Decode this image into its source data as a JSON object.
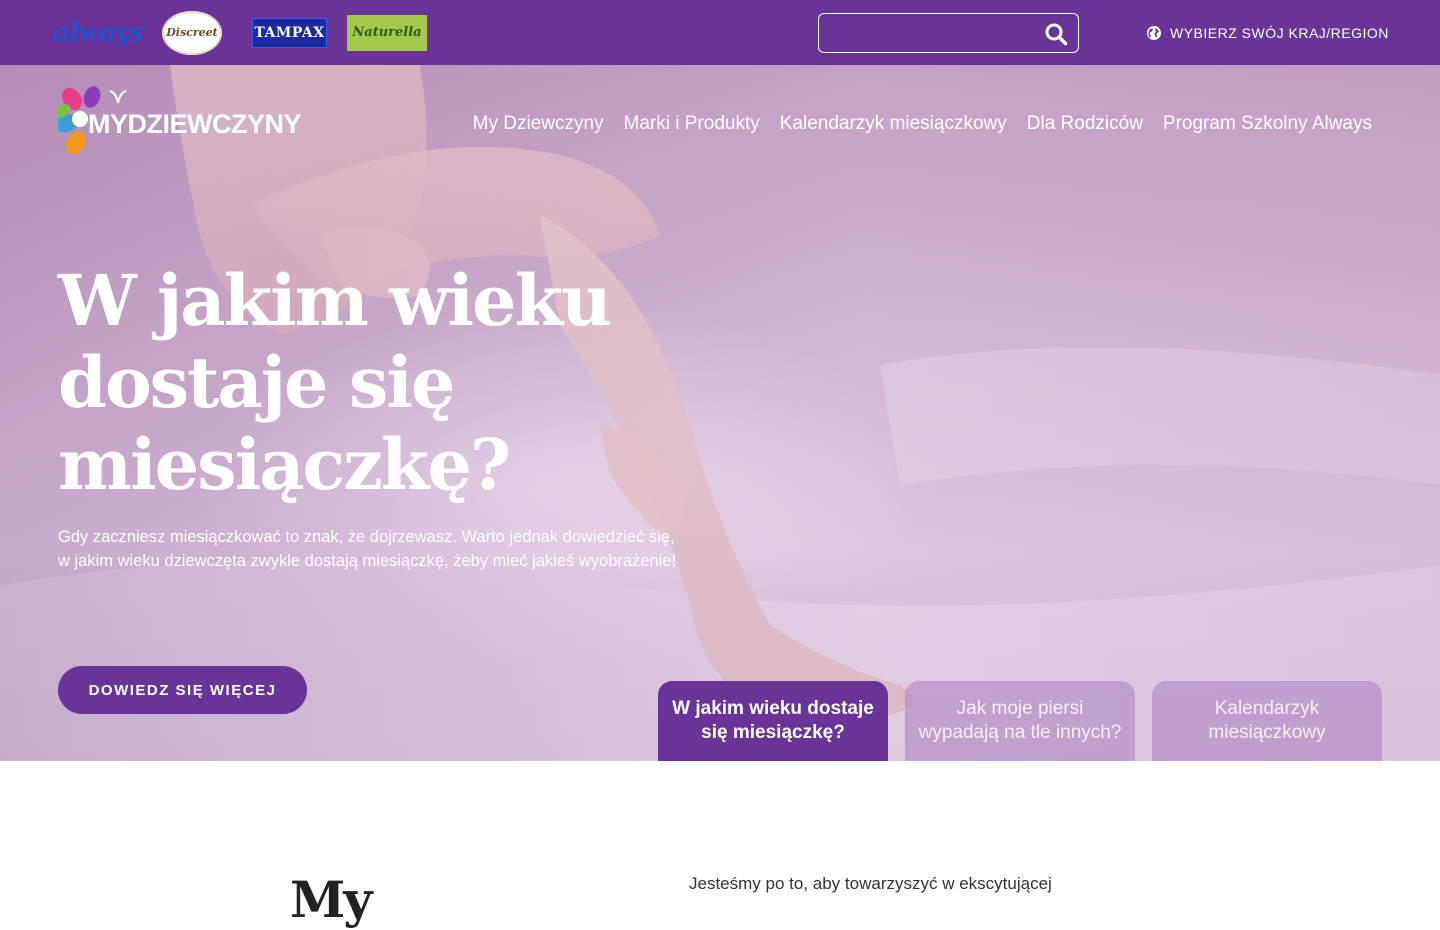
{
  "topbar": {
    "brands": [
      {
        "name": "always",
        "label": "always"
      },
      {
        "name": "discreet",
        "label": "Discreet"
      },
      {
        "name": "tampax",
        "label": "TAMPAX"
      },
      {
        "name": "naturella",
        "label": "Naturella"
      }
    ],
    "search": {
      "value": "",
      "placeholder": "",
      "icon": "search-icon"
    },
    "region": {
      "label": "WYBIERZ SWÓJ KRAJ/REGION",
      "icon": "globe-icon"
    }
  },
  "header": {
    "logo_text": "MYDZIEWCZYNY",
    "nav": [
      {
        "label": "My Dziewczyny"
      },
      {
        "label": "Marki i Produkty"
      },
      {
        "label": "Kalendarzyk miesiączkowy"
      },
      {
        "label": "Dla Rodziców"
      },
      {
        "label": "Program Szkolny Always"
      }
    ]
  },
  "hero": {
    "title": "W jakim wieku dostaje się miesiączkę?",
    "description": "Gdy zaczniesz miesiączkować to znak, że dojrzewasz. Warto jednak dowiedzieć się, w jakim wieku dziewczęta zwykle dostają miesiączkę, żeby mieć jakieś wyobrażenie!",
    "cta_label": "DOWIEDZ SIĘ WIĘCEJ",
    "tabs": [
      {
        "label": "W jakim wieku dostaje się miesiączkę?",
        "active": true
      },
      {
        "label": "Jak moje piersi wypadają na tle innych?",
        "active": false
      },
      {
        "label": "Kalendarzyk miesiączkowy",
        "active": false
      }
    ]
  },
  "section": {
    "title": "My",
    "text": "Jesteśmy po to, aby towarzyszyć w ekscytującej"
  },
  "colors": {
    "brand_purple": "#6a3397",
    "white": "#ffffff"
  }
}
